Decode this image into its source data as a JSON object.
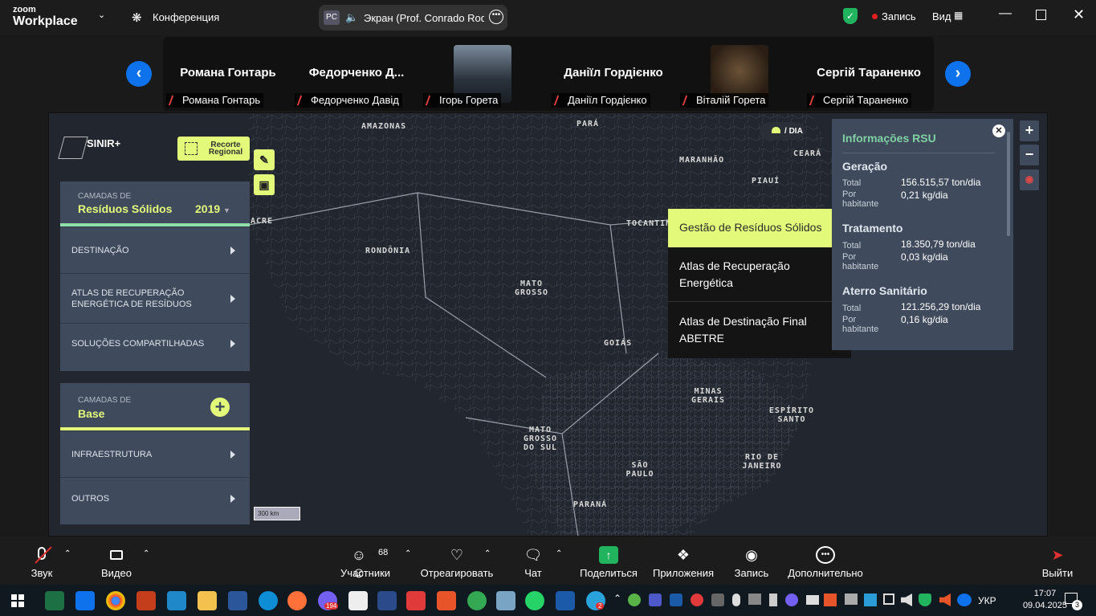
{
  "titlebar": {
    "logo_top": "zoom",
    "logo_bottom": "Workplace",
    "meeting_label": "Конференция",
    "share_badge": "PC",
    "share_label": "Экран (Prof. Conrado Rodrig",
    "record_label": "Запись",
    "view_label": "Вид"
  },
  "participants": [
    {
      "name": "Романа Гонтарь",
      "tag": "Романа Гонтарь",
      "photo": false
    },
    {
      "name": "Федорченко  Д...",
      "tag": "Федорченко Давід",
      "photo": false
    },
    {
      "name": "",
      "tag": "Ігорь Горета",
      "photo": true,
      "photo_color": "#3a4450"
    },
    {
      "name": "Даніїл Гордієнко",
      "tag": "Даніїл Гордієнко",
      "photo": false
    },
    {
      "name": "",
      "tag": "Віталій Горета",
      "photo": true,
      "photo_color": "#4a3c2c"
    },
    {
      "name": "Сергій Тараненко",
      "tag": "Сергій Тараненко",
      "photo": false
    }
  ],
  "map": {
    "brand": "SINIR+",
    "regional_btn": "Recorte Regional",
    "mode_label": "DIA",
    "scale_label": "300 km",
    "states": {
      "amazonas": "AMAZONAS",
      "para": "PARÁ",
      "maranhao": "MARANHÃO",
      "ceara": "CEARÁ",
      "piaui": "PIAUÍ",
      "acre": "ACRE",
      "rondonia": "RONDÔNIA",
      "tocantins": "TOCANTIN",
      "mato_grosso": "MATO GROSSO",
      "goias": "GOIÁS",
      "minas_gerais": "MINAS GERAIS",
      "espirito_santo": "ESPÍRITO SANTO",
      "mato_grosso_sul": "MATO GROSSO DO SUL",
      "sao_paulo": "SÃO PAULO",
      "rio_de_janeiro": "RIO DE JANEIRO",
      "parana": "PARANÁ"
    }
  },
  "left_panel": {
    "layers_small": "CAMADAS DE",
    "layers_title": "Resíduos Sólidos",
    "year": "2019",
    "rows": [
      "DESTINAÇÃO",
      "ATLAS DE RECUPERAÇÃO ENERGÉTICA DE RESÍDUOS",
      "SOLUÇÕES COMPARTILHADAS"
    ],
    "base_small": "CAMADAS DE",
    "base_title": "Base",
    "base_rows": [
      "INFRAESTRUTURA",
      "OUTROS"
    ]
  },
  "dropdown": {
    "items": [
      "Gestão de Resíduos Sólidos",
      "Atlas de Recuperação Energética",
      "Atlas de Destinação Final ABETRE"
    ]
  },
  "info_panel": {
    "title": "Informações RSU",
    "sections": [
      {
        "heading": "Geração",
        "total_label": "Total",
        "total_value": "156.515,57 ton/dia",
        "per_label": "Por habitante",
        "per_value": "0,21 kg/dia"
      },
      {
        "heading": "Tratamento",
        "total_label": "Total",
        "total_value": "18.350,79 ton/dia",
        "per_label": "Por habitante",
        "per_value": "0,03 kg/dia"
      },
      {
        "heading": "Aterro Sanitário",
        "total_label": "Total",
        "total_value": "121.256,29 ton/dia",
        "per_label": "Por habitante",
        "per_value": "0,16 kg/dia"
      }
    ]
  },
  "toolbar": {
    "audio": "Звук",
    "video": "Видео",
    "participants": "Участники",
    "participants_count": "68",
    "react": "Отреагировать",
    "chat": "Чат",
    "share": "Поделиться",
    "apps": "Приложения",
    "record": "Запись",
    "more": "Дополнительно",
    "leave": "Выйти"
  },
  "taskbar": {
    "lang": "УКР",
    "time": "17:07",
    "date": "09.04.2025",
    "notif": "3",
    "viber_badge": "194",
    "telegram_badge": "2"
  },
  "colors": {
    "accent": "#e3f97a",
    "zoom_blue": "#0e72ed",
    "panel": "#3f4b5c",
    "info_heading": "#7fd1a3"
  }
}
